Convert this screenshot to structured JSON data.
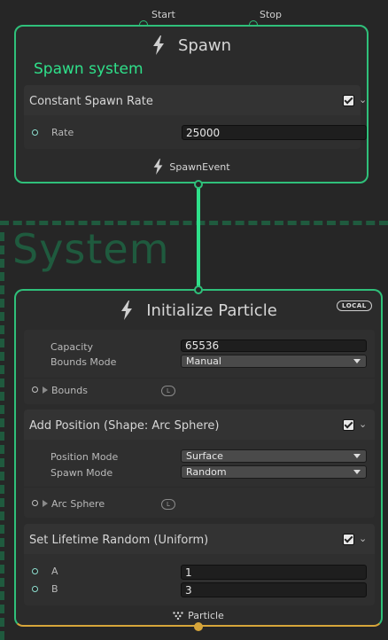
{
  "spawn": {
    "inputs": {
      "start": "Start",
      "stop": "Stop"
    },
    "title": "Spawn",
    "subtitle": "Spawn system",
    "block": {
      "title": "Constant Spawn Rate",
      "rate_label": "Rate",
      "rate_value": "25000"
    },
    "event_label": "SpawnEvent"
  },
  "system": {
    "title": "System"
  },
  "init": {
    "title": "Initialize Particle",
    "space_badge": "LOCAL",
    "capacity_label": "Capacity",
    "capacity_value": "65536",
    "bounds_mode_label": "Bounds Mode",
    "bounds_mode_value": "Manual",
    "bounds_label": "Bounds",
    "bounds_space": "L",
    "position_block": {
      "title": "Add Position (Shape: Arc Sphere)",
      "position_mode_label": "Position Mode",
      "position_mode_value": "Surface",
      "spawn_mode_label": "Spawn Mode",
      "spawn_mode_value": "Random",
      "arc_sphere_label": "Arc Sphere",
      "arc_sphere_space": "L"
    },
    "lifetime_block": {
      "title": "Set Lifetime Random (Uniform)",
      "a_label": "A",
      "a_value": "1",
      "b_label": "B",
      "b_value": "3"
    },
    "output_label": "Particle"
  },
  "colors": {
    "spawn_accent": "#2fc07a",
    "system_frame": "#1f5a3e",
    "particle_output": "#d6a53a"
  }
}
